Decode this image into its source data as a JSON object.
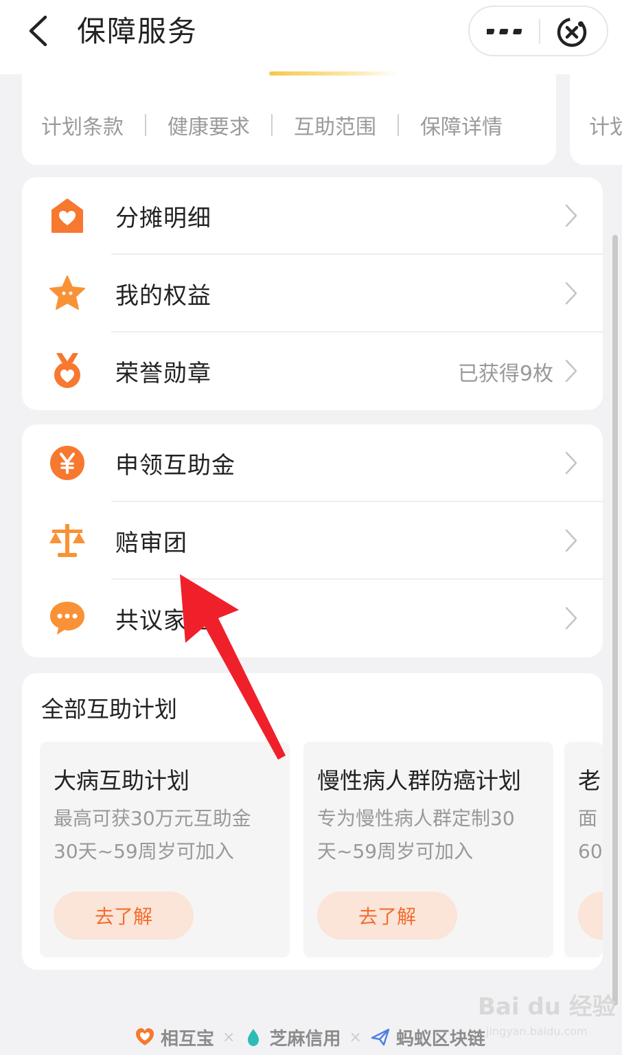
{
  "header": {
    "title": "保障服务",
    "back_icon": "back-chevron-icon",
    "more_icon": "more-dots-icon",
    "close_icon": "close-target-icon"
  },
  "tabs": [
    {
      "label": "计划条款"
    },
    {
      "label": "健康要求"
    },
    {
      "label": "互助范围"
    },
    {
      "label": "保障详情"
    },
    {
      "label": "计划"
    }
  ],
  "menu_group_1": [
    {
      "label": "分摊明细",
      "icon": "house-heart-icon",
      "value": ""
    },
    {
      "label": "我的权益",
      "icon": "star-face-icon",
      "value": ""
    },
    {
      "label": "荣誉勋章",
      "icon": "medal-heart-icon",
      "value": "已获得9枚"
    }
  ],
  "menu_group_2": [
    {
      "label": "申领互助金",
      "icon": "yen-coin-icon",
      "value": ""
    },
    {
      "label": "赔审团",
      "icon": "scale-icon",
      "value": ""
    },
    {
      "label": "共议家园",
      "icon": "chat-bubble-icon",
      "value": ""
    }
  ],
  "plans": {
    "title": "全部互助计划",
    "items": [
      {
        "title": "大病互助计划",
        "desc1": "最高可获30万元互助金",
        "desc2": "30天~59周岁可加入",
        "button": "去了解"
      },
      {
        "title": "慢性病人群防癌计划",
        "desc1": "专为慢性病人群定制30",
        "desc2": "天~59周岁可加入",
        "button": "去了解"
      },
      {
        "title": "老",
        "desc1": "面",
        "desc2": "60",
        "button": ""
      }
    ]
  },
  "footer": {
    "brand1": "相互宝",
    "brand2": "芝麻信用",
    "brand3": "蚂蚁区块链",
    "separator": "×"
  },
  "watermark": {
    "text": "Bai du 经验",
    "sub": "jingyan.baidu.com"
  },
  "colors": {
    "accent": "#f26e2d",
    "icon_orange": "#f7782f",
    "arrow": "#f0202a"
  }
}
